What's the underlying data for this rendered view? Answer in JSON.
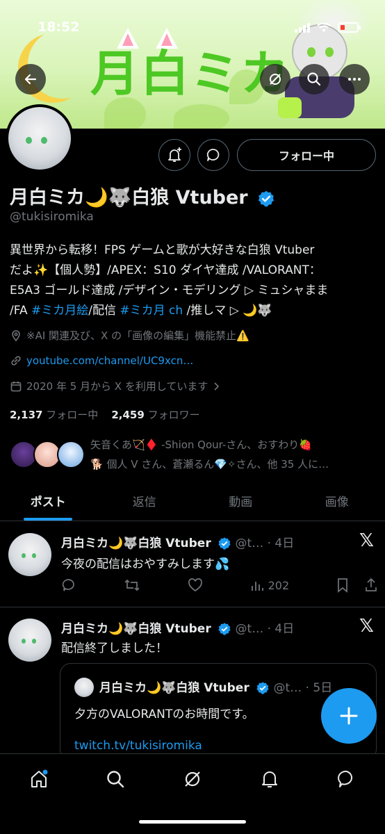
{
  "status_bar": {
    "time": "18:52"
  },
  "banner": {
    "title_text": "月白ミカ"
  },
  "profile": {
    "follow_button": "フォロー中",
    "display_name": "月白ミカ🌙🐺白狼 Vtuber",
    "handle": "@tukisiromika",
    "bio_lines": [
      "異世界から転移！FPS ゲームと歌が大好きな白狼 Vtuber",
      "だよ✨【個人勢】/APEX：S10 ダイヤ達成 /VALORANT：",
      "E5A3 ゴールド達成 /デザイン・モデリング ▷ ミュシャまま",
      "/FA "
    ],
    "bio_tag1": "#ミカ月絵",
    "bio_mid": "/配信 ",
    "bio_tag2": "#ミカ月 ch",
    "bio_end": " /推しマ ▷ 🌙🐺",
    "location": "※AI 関連及び、X の「画像の編集」機能禁止⚠️",
    "website": "youtube.com/channel/UC9xcn…",
    "joined": "2020 年 5 月から X を利用しています",
    "following_count": "2,137",
    "following_label": "フォロー中",
    "followers_count": "2,459",
    "followers_label": "フォロワー",
    "followed_by_line1": "矢音くあ🏹♦️ -Shion Qour-さん、おすわり🍓",
    "followed_by_line2": "🐕 個人 V さん、蒼瀬るん💎✧さん、他 35 人に…"
  },
  "tabs": [
    {
      "label": "ポスト",
      "active": true
    },
    {
      "label": "返信",
      "active": false
    },
    {
      "label": "動画",
      "active": false
    },
    {
      "label": "画像",
      "active": false
    }
  ],
  "posts": [
    {
      "name": "月白ミカ🌙🐺白狼 Vtuber",
      "handle_time": "@t… · 4日",
      "text": "今夜の配信はおやすみします💦",
      "views": "202"
    },
    {
      "name": "月白ミカ🌙🐺白狼 Vtuber",
      "handle_time": "@t… · 4日",
      "text": "配信終了しました！",
      "quote": {
        "name": "月白ミカ🌙🐺白狼 Vtuber",
        "handle_time": "@t… · 5日",
        "text": "夕方のVALORANTのお時間です。",
        "link": "twitch.tv/tukisiromika"
      }
    }
  ],
  "colors": {
    "accent": "#1d9bf0",
    "muted": "#71767b",
    "text": "#e7e9ea",
    "border": "#2f3336"
  },
  "icons": [
    "back-icon",
    "grok-icon",
    "search-icon",
    "more-icon",
    "notify-plus-icon",
    "message-icon",
    "location-icon",
    "link-icon",
    "calendar-icon",
    "reply-icon",
    "repost-icon",
    "like-icon",
    "views-icon",
    "bookmark-icon",
    "share-icon",
    "x-logo-icon",
    "compose-icon",
    "home-icon",
    "search-nav-icon",
    "grok-nav-icon",
    "notifications-icon",
    "messages-icon"
  ]
}
